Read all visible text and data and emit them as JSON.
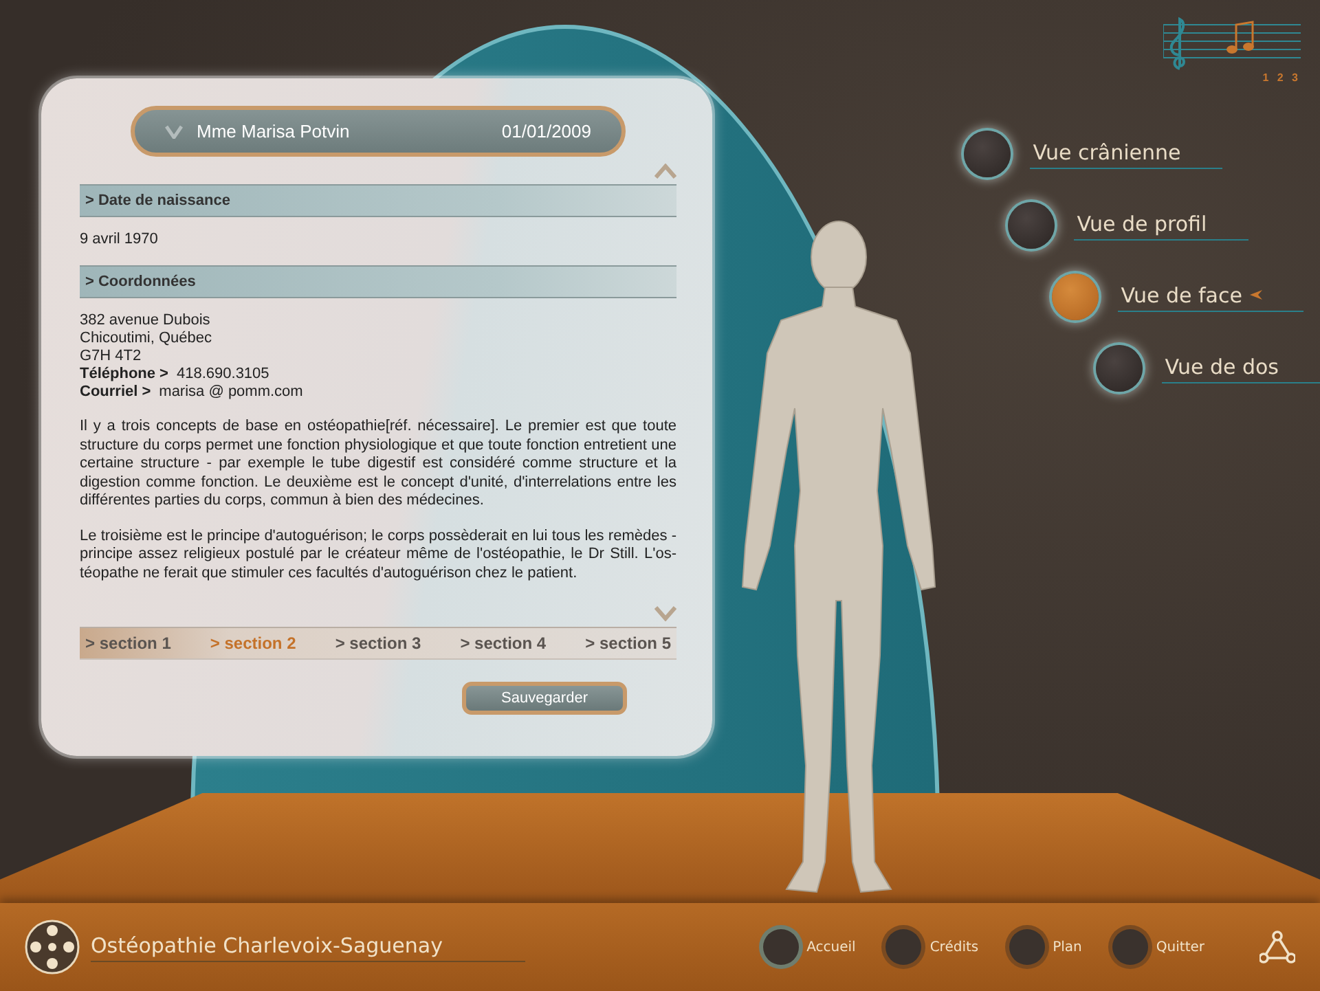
{
  "patient_header": {
    "name": "Mme Marisa Potvin",
    "date": "01/01/2009"
  },
  "sections": [
    {
      "kind": "heading",
      "text": "> Date de naissance"
    },
    {
      "kind": "plain",
      "lines": [
        "9 avril 1970"
      ]
    },
    {
      "kind": "heading",
      "text": "> Coordonnées"
    },
    {
      "kind": "contact",
      "lines": [
        "382 avenue Dubois",
        "Chicoutimi, Québec",
        "G7H 4T2"
      ],
      "fields": [
        {
          "label": "Téléphone >",
          "value": "418.690.3105"
        },
        {
          "label": "Courriel >",
          "value": "marisa @ pomm.com"
        }
      ]
    },
    {
      "kind": "paragraph",
      "text": "Il y a trois concepts de base en ostéopathie[réf. nécessaire]. Le premier est que toute structure du corps permet une fonction physiologique et que toute fonction entretient une certaine structure - par exemple le tube digestif est considéré comme structure et la digestion comme fonction. Le deuxième est le concept d'unité, d'interrelations entre les différentes parties du corps, commun à bien des médecines."
    },
    {
      "kind": "paragraph",
      "text": "Le troisième est le principe d'autoguérison; le corps possèderait en lui tous les remèdes - principe assez religieux postulé par le créateur même de l'ostéopathie, le Dr Still. L'os-téopathe ne ferait que stimuler ces facultés d'autoguérison chez le patient."
    }
  ],
  "section_tabs": [
    {
      "label": "> section 1",
      "selected": false
    },
    {
      "label": "> section 2",
      "selected": true
    },
    {
      "label": "> section 3",
      "selected": false
    },
    {
      "label": "> section 4",
      "selected": false
    },
    {
      "label": "> section 5",
      "selected": false
    }
  ],
  "save_button": "Sauvegarder",
  "music": {
    "tracks": "1 2 3"
  },
  "views": [
    {
      "label": "Vue crânienne",
      "selected": false
    },
    {
      "label": "Vue de profil",
      "selected": false
    },
    {
      "label": "Vue de face",
      "selected": true
    },
    {
      "label": "Vue de dos",
      "selected": false
    }
  ],
  "footer": {
    "title": "Ostéopathie Charlevoix-Saguenay",
    "nav": [
      {
        "label": "Accueil",
        "selected": true
      },
      {
        "label": "Crédits",
        "selected": false
      },
      {
        "label": "Plan",
        "selected": false
      },
      {
        "label": "Quitter",
        "selected": false
      }
    ]
  }
}
